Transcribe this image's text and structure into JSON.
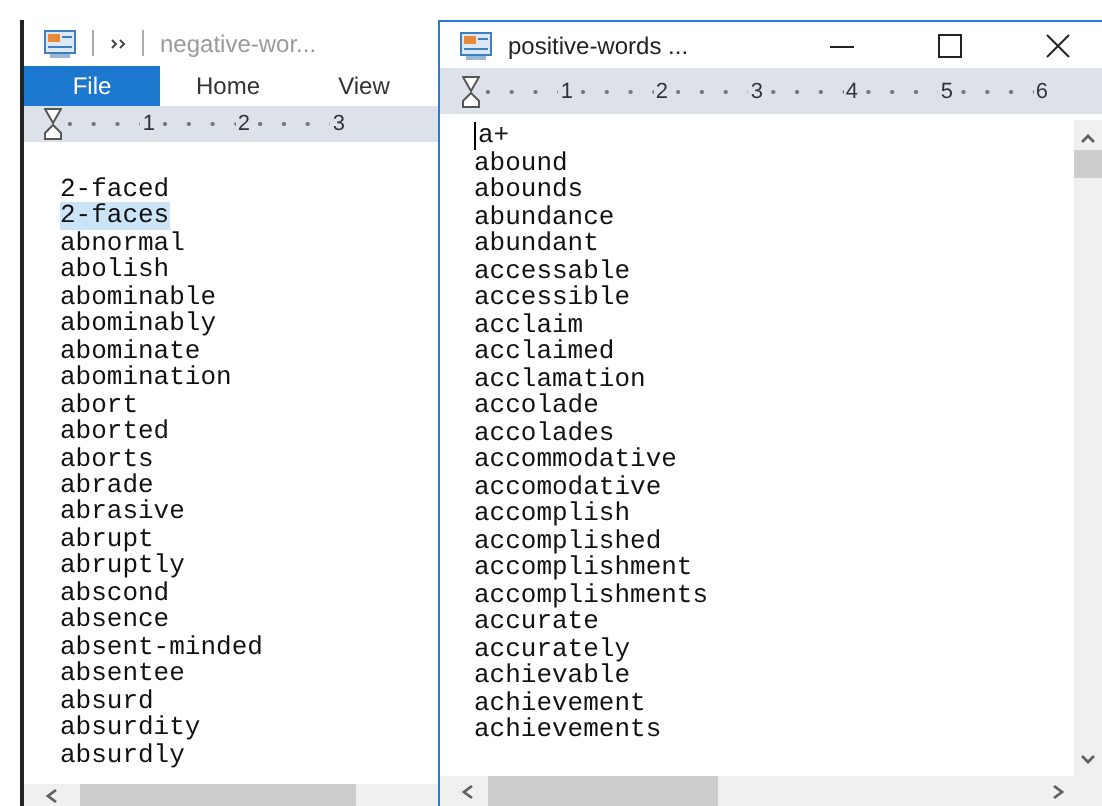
{
  "back_window": {
    "title": "negative-wor...",
    "tabs": [
      {
        "label": "File",
        "selected": true
      },
      {
        "label": "Home",
        "selected": false
      },
      {
        "label": "View",
        "selected": false
      }
    ],
    "ruler": [
      "1",
      "2",
      "3"
    ],
    "words": [
      {
        "text": "2-faced",
        "selected": false
      },
      {
        "text": "2-faces",
        "selected": true
      },
      {
        "text": "abnormal",
        "selected": false
      },
      {
        "text": "abolish",
        "selected": false
      },
      {
        "text": "abominable",
        "selected": false
      },
      {
        "text": "abominably",
        "selected": false
      },
      {
        "text": "abominate",
        "selected": false
      },
      {
        "text": "abomination",
        "selected": false
      },
      {
        "text": "abort",
        "selected": false
      },
      {
        "text": "aborted",
        "selected": false
      },
      {
        "text": "aborts",
        "selected": false
      },
      {
        "text": "abrade",
        "selected": false
      },
      {
        "text": "abrasive",
        "selected": false
      },
      {
        "text": "abrupt",
        "selected": false
      },
      {
        "text": "abruptly",
        "selected": false
      },
      {
        "text": "abscond",
        "selected": false
      },
      {
        "text": "absence",
        "selected": false
      },
      {
        "text": "absent-minded",
        "selected": false
      },
      {
        "text": "absentee",
        "selected": false
      },
      {
        "text": "absurd",
        "selected": false
      },
      {
        "text": "absurdity",
        "selected": false
      },
      {
        "text": "absurdly",
        "selected": false
      }
    ]
  },
  "front_window": {
    "title": "positive-words ...",
    "ruler": [
      "1",
      "2",
      "3",
      "4",
      "5",
      "6"
    ],
    "words": [
      "a+",
      "abound",
      "abounds",
      "abundance",
      "abundant",
      "accessable",
      "accessible",
      "acclaim",
      "acclaimed",
      "acclamation",
      "accolade",
      "accolades",
      "accommodative",
      "accomodative",
      "accomplish",
      "accomplished",
      "accomplishment",
      "accomplishments",
      "accurate",
      "accurately",
      "achievable",
      "achievement",
      "achievements"
    ]
  }
}
